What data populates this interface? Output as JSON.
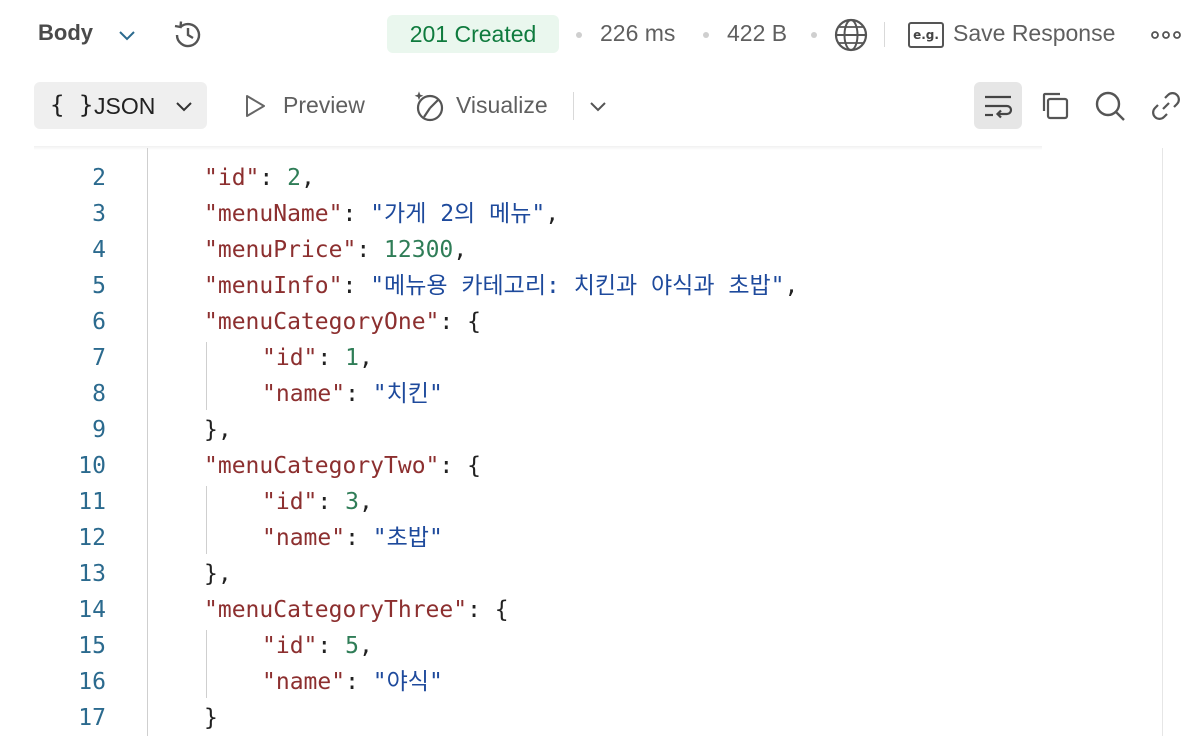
{
  "topbar": {
    "body_label": "Body",
    "status": "201 Created",
    "time": "226 ms",
    "size": "422 B",
    "eg_label": "e.g.",
    "save_response": "Save Response"
  },
  "toolbar": {
    "format_label": "JSON",
    "format_braces": "{ }",
    "preview_label": "Preview",
    "visualize_label": "Visualize"
  },
  "colors": {
    "status_bg": "#eaf7ee",
    "status_text": "#0f7b3e",
    "key": "#8c2f2f",
    "string": "#1e4a9c",
    "number": "#2f7d57",
    "line_number": "#2b6a8e"
  },
  "editor": {
    "lines": [
      {
        "n": "2",
        "indent": 1,
        "tokens": [
          [
            "k",
            "\"id\""
          ],
          [
            "p",
            ": "
          ],
          [
            "n",
            "2"
          ],
          [
            "p",
            ","
          ]
        ]
      },
      {
        "n": "3",
        "indent": 1,
        "tokens": [
          [
            "k",
            "\"menuName\""
          ],
          [
            "p",
            ": "
          ],
          [
            "s",
            "\"가게 2의 메뉴\""
          ],
          [
            "p",
            ","
          ]
        ]
      },
      {
        "n": "4",
        "indent": 1,
        "tokens": [
          [
            "k",
            "\"menuPrice\""
          ],
          [
            "p",
            ": "
          ],
          [
            "n",
            "12300"
          ],
          [
            "p",
            ","
          ]
        ]
      },
      {
        "n": "5",
        "indent": 1,
        "tokens": [
          [
            "k",
            "\"menuInfo\""
          ],
          [
            "p",
            ": "
          ],
          [
            "s",
            "\"메뉴용 카테고리: 치킨과 야식과 초밥\""
          ],
          [
            "p",
            ","
          ]
        ]
      },
      {
        "n": "6",
        "indent": 1,
        "tokens": [
          [
            "k",
            "\"menuCategoryOne\""
          ],
          [
            "p",
            ": {"
          ]
        ]
      },
      {
        "n": "7",
        "indent": 2,
        "tokens": [
          [
            "k",
            "\"id\""
          ],
          [
            "p",
            ": "
          ],
          [
            "n",
            "1"
          ],
          [
            "p",
            ","
          ]
        ]
      },
      {
        "n": "8",
        "indent": 2,
        "tokens": [
          [
            "k",
            "\"name\""
          ],
          [
            "p",
            ": "
          ],
          [
            "s",
            "\"치킨\""
          ]
        ]
      },
      {
        "n": "9",
        "indent": 1,
        "tokens": [
          [
            "p",
            "},"
          ]
        ]
      },
      {
        "n": "10",
        "indent": 1,
        "tokens": [
          [
            "k",
            "\"menuCategoryTwo\""
          ],
          [
            "p",
            ": {"
          ]
        ]
      },
      {
        "n": "11",
        "indent": 2,
        "tokens": [
          [
            "k",
            "\"id\""
          ],
          [
            "p",
            ": "
          ],
          [
            "n",
            "3"
          ],
          [
            "p",
            ","
          ]
        ]
      },
      {
        "n": "12",
        "indent": 2,
        "tokens": [
          [
            "k",
            "\"name\""
          ],
          [
            "p",
            ": "
          ],
          [
            "s",
            "\"초밥\""
          ]
        ]
      },
      {
        "n": "13",
        "indent": 1,
        "tokens": [
          [
            "p",
            "},"
          ]
        ]
      },
      {
        "n": "14",
        "indent": 1,
        "tokens": [
          [
            "k",
            "\"menuCategoryThree\""
          ],
          [
            "p",
            ": {"
          ]
        ]
      },
      {
        "n": "15",
        "indent": 2,
        "tokens": [
          [
            "k",
            "\"id\""
          ],
          [
            "p",
            ": "
          ],
          [
            "n",
            "5"
          ],
          [
            "p",
            ","
          ]
        ]
      },
      {
        "n": "16",
        "indent": 2,
        "tokens": [
          [
            "k",
            "\"name\""
          ],
          [
            "p",
            ": "
          ],
          [
            "s",
            "\"야식\""
          ]
        ]
      },
      {
        "n": "17",
        "indent": 1,
        "tokens": [
          [
            "p",
            "}"
          ]
        ]
      }
    ]
  }
}
